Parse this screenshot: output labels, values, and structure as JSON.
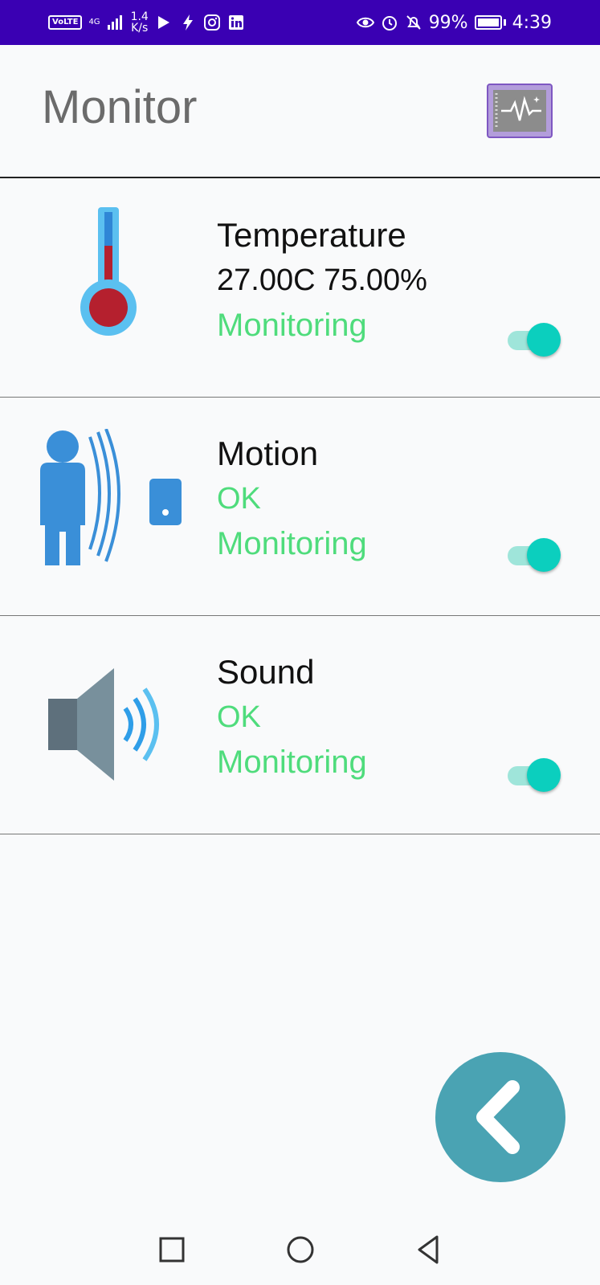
{
  "status_bar": {
    "volte": "VoLTE",
    "network": "4G",
    "speed_value": "1.4",
    "speed_unit": "K/s",
    "battery": "99%",
    "time": "4:39",
    "icons_left": [
      "play-store-icon",
      "bolt-icon",
      "instagram-icon",
      "linkedin-icon"
    ],
    "icons_right": [
      "eye-icon",
      "alarm-icon",
      "bell-off-icon",
      "battery-icon"
    ]
  },
  "header": {
    "title": "Monitor",
    "icon": "monitor-pulse-icon"
  },
  "sensors": [
    {
      "icon": "thermometer-icon",
      "title": "Temperature",
      "value": "27.00C 75.00%",
      "status": "Monitoring",
      "toggle_on": true
    },
    {
      "icon": "motion-sensor-icon",
      "title": "Motion",
      "value": "OK",
      "status": "Monitoring",
      "toggle_on": true
    },
    {
      "icon": "speaker-icon",
      "title": "Sound",
      "value": "OK",
      "status": "Monitoring",
      "toggle_on": true
    }
  ],
  "fab": {
    "icon": "chevron-left-icon"
  },
  "nav": [
    "recents-icon",
    "home-icon",
    "back-icon"
  ],
  "colors": {
    "status_bar": "#3a00b3",
    "status_green": "#4fdc7c",
    "toggle_thumb": "#0bcfbe",
    "toggle_track": "#9fe5da",
    "fab": "#4aa3b3"
  }
}
